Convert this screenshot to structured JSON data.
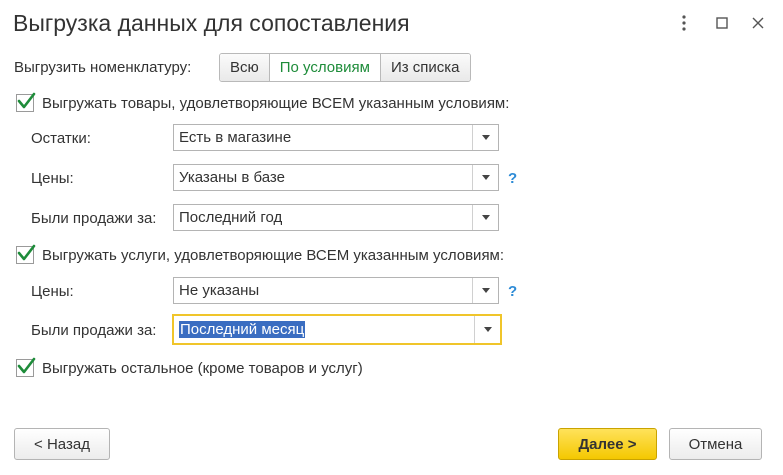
{
  "window": {
    "title": "Выгрузка данных для сопоставления"
  },
  "export_nomenclature": {
    "label": "Выгрузить номенклатуру:",
    "options": [
      "Всю",
      "По условиям",
      "Из списка"
    ],
    "selected": "По условиям"
  },
  "goods": {
    "checkbox_label": "Выгружать товары, удовлетворяющие ВСЕМ указанным условиям:",
    "checked": true,
    "stock_label": "Остатки:",
    "stock_value": "Есть в магазине",
    "prices_label": "Цены:",
    "prices_value": "Указаны в базе",
    "prices_help": "?",
    "sales_label": "Были продажи за:",
    "sales_value": "Последний год"
  },
  "services": {
    "checkbox_label": "Выгружать услуги, удовлетворяющие ВСЕМ указанным условиям:",
    "checked": true,
    "prices_label": "Цены:",
    "prices_value": "Не указаны",
    "prices_help": "?",
    "sales_label": "Были продажи за:",
    "sales_value": "Последний месяц"
  },
  "other": {
    "checkbox_label": "Выгружать остальное (кроме товаров и услуг)",
    "checked": true
  },
  "footer": {
    "back_label": "< Назад",
    "next_label": "Далее >",
    "cancel_label": "Отмена"
  },
  "colors": {
    "accent_green": "#1e8c3a",
    "primary_yellow": "#f4c800",
    "focus_border": "#f0c52a",
    "selection_blue": "#3a6dc1",
    "help_blue": "#2d8bd6"
  }
}
